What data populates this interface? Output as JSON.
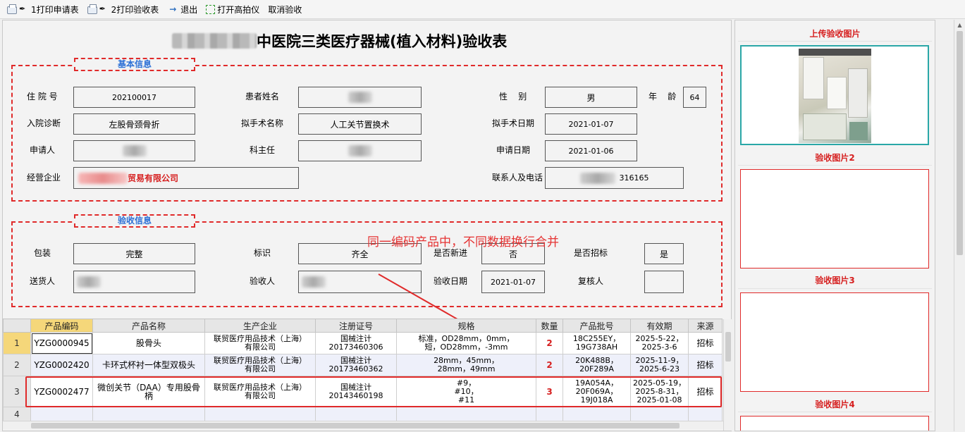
{
  "toolbar": {
    "print_request": "1打印申请表",
    "print_acceptance": "2打印验收表",
    "exit": "退出",
    "open_camera": "打开高拍仪",
    "cancel_acceptance": "取消验收"
  },
  "form": {
    "title": "中医院三类医疗器械(植入材料)验收表",
    "basic_info": {
      "section_title": "基本信息",
      "admission_no_label": "住 院 号",
      "admission_no": "202100017",
      "patient_name_label": "患者姓名",
      "gender_label": "性    别",
      "gender": "男",
      "age_label": "年    龄",
      "age": "64",
      "diagnosis_label": "入院诊断",
      "diagnosis": "左股骨颈骨折",
      "surgery_name_label": "拟手术名称",
      "surgery_name": "人工关节置换术",
      "surgery_date_label": "拟手术日期",
      "surgery_date": "2021-01-07",
      "applicant_label": "申请人",
      "director_label": "科主任",
      "apply_date_label": "申请日期",
      "apply_date": "2021-01-06",
      "supplier_label": "经营企业",
      "supplier_visible": "贸易有限公司",
      "contact_label": "联系人及电话",
      "contact_visible": "316165"
    },
    "acceptance_info": {
      "section_title": "验收信息",
      "package_label": "包装",
      "package": "完整",
      "marking_label": "标识",
      "marking": "齐全",
      "new_label": "是否新进",
      "new": "否",
      "bid_label": "是否招标",
      "bid": "是",
      "deliverer_label": "送货人",
      "inspector_label": "验收人",
      "accept_date_label": "验收日期",
      "accept_date": "2021-01-07",
      "reviewer_label": "复核人"
    },
    "annotation": "同一编码产品中，不同数据换行合并"
  },
  "grid": {
    "headers": [
      "产品编码",
      "产品名称",
      "生产企业",
      "注册证号",
      "规格",
      "数量",
      "产品批号",
      "有效期",
      "来源"
    ],
    "rows": [
      {
        "num": "1",
        "code": "YZG0000945",
        "name": "股骨头",
        "maker": [
          "联贸医疗用品技术（上海）",
          "有限公司"
        ],
        "reg": [
          "国械注计",
          "20173460306"
        ],
        "spec": [
          "标准，OD28mm，0mm，",
          "短，OD28mm，-3mm"
        ],
        "qty": "2",
        "batch": [
          "18C255EY，",
          "19G738AH"
        ],
        "expiry": [
          "2025-5-22，",
          "2025-3-6"
        ],
        "source": "招标"
      },
      {
        "num": "2",
        "code": "YZG0002420",
        "name": "卡环式杯衬一体型双极头",
        "maker": [
          "联贸医疗用品技术（上海）",
          "有限公司"
        ],
        "reg": [
          "国械注计",
          "20173460362"
        ],
        "spec": [
          "28mm，45mm，",
          "28mm，49mm"
        ],
        "qty": "2",
        "batch": [
          "20K488B，",
          "20F289A"
        ],
        "expiry": [
          "2025-11-9，",
          "2025-6-23"
        ],
        "source": "招标"
      },
      {
        "num": "3",
        "code": "YZG0002477",
        "name": "微创关节（DAA）专用股骨柄",
        "maker": [
          "联贸医疗用品技术（上海）",
          "有限公司"
        ],
        "reg": [
          "国械注计",
          "20143460198"
        ],
        "spec": [
          "#9，",
          "#10，",
          "#11"
        ],
        "qty": "3",
        "batch": [
          "19A054A，",
          "20F069A，",
          "19J018A"
        ],
        "expiry": [
          "2025-05-19，",
          "2025-8-31，",
          "2025-01-08"
        ],
        "source": "招标"
      },
      {
        "num": "4"
      }
    ]
  },
  "images": {
    "upload_title": "上传验收图片",
    "img2_title": "验收图片2",
    "img3_title": "验收图片3",
    "img4_title": "验收图片4"
  }
}
